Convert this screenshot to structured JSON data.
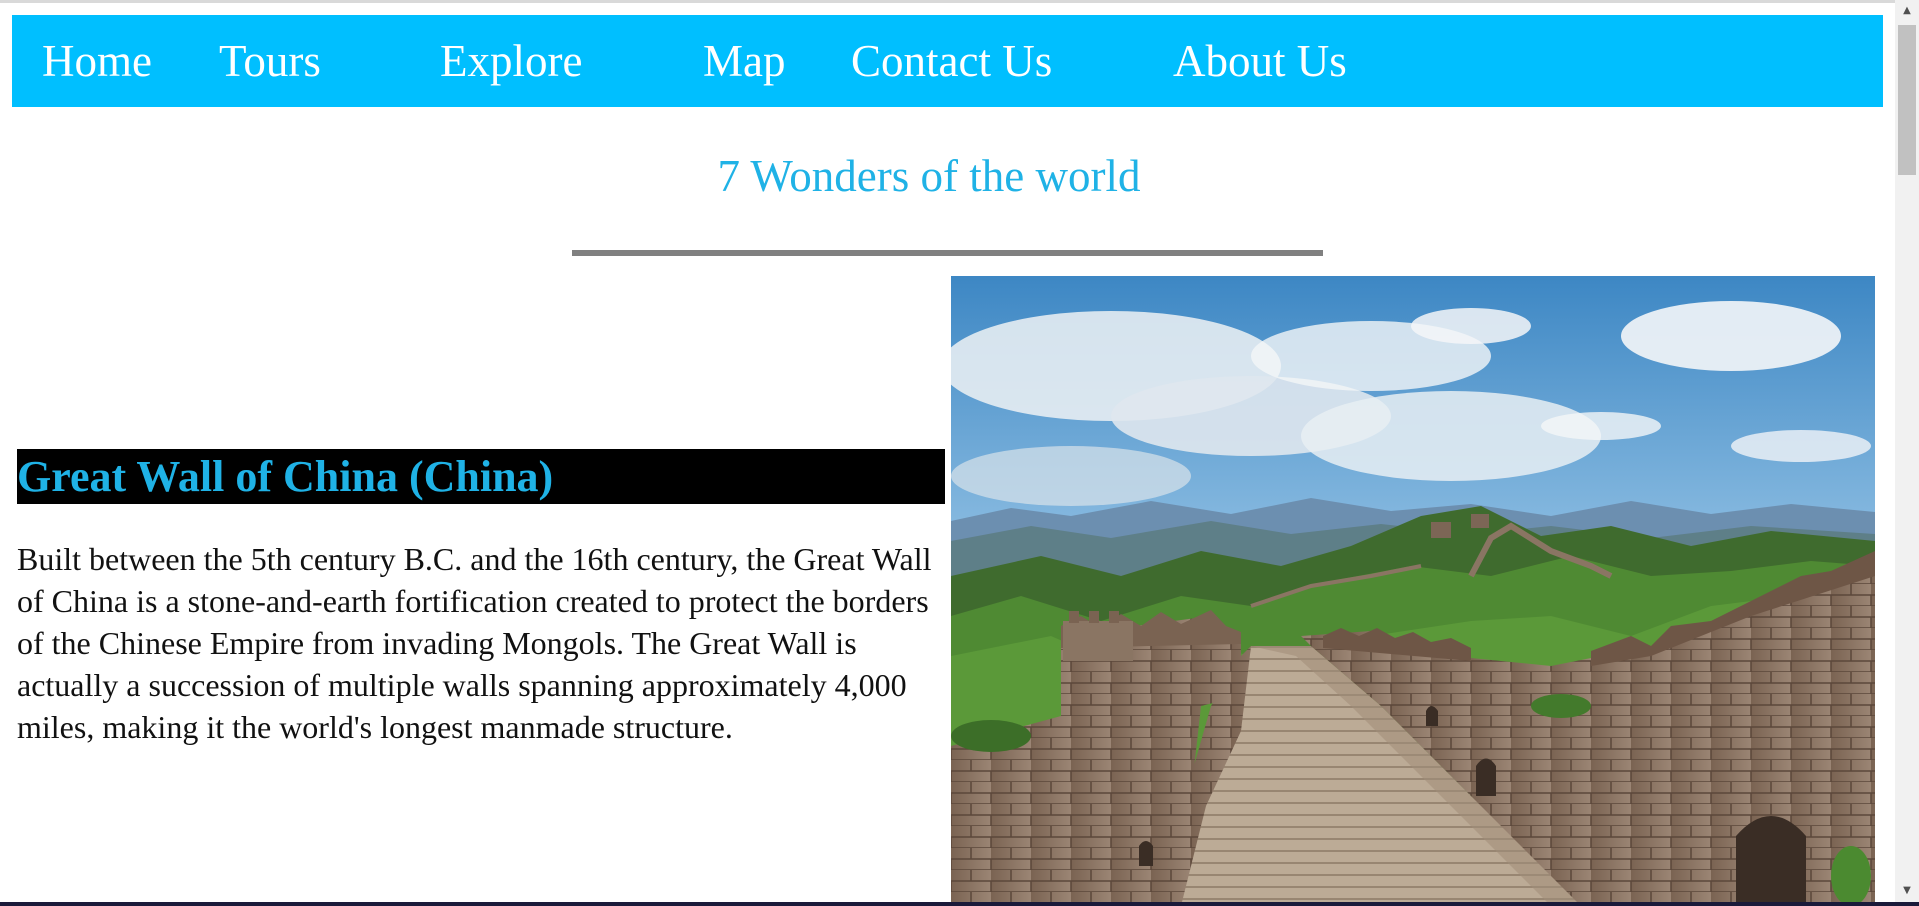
{
  "nav": {
    "items": [
      {
        "label": "Home"
      },
      {
        "label": "Tours"
      },
      {
        "label": "Explore"
      },
      {
        "label": "Map"
      },
      {
        "label": "Contact Us"
      },
      {
        "label": "About Us"
      }
    ]
  },
  "main": {
    "title": "7 Wonders of the world",
    "section": {
      "heading": "Great Wall of China (China)",
      "body": "Built between the 5th century B.C. and the 16th century, the Great Wall of China is a stone-and-earth fortification created to protect the borders of the Chinese Empire from invading Mongols. The Great Wall is actually a succession of multiple walls spanning approximately 4,000 miles, making it the world's longest manmade structure."
    }
  },
  "colors": {
    "nav_background": "#00bfff",
    "accent_text": "#1fb2e6",
    "heading_background": "#000000",
    "divider": "#808080"
  },
  "icons": {
    "scroll_up": "scroll-up-arrow-icon",
    "scroll_down": "scroll-down-arrow-icon"
  }
}
